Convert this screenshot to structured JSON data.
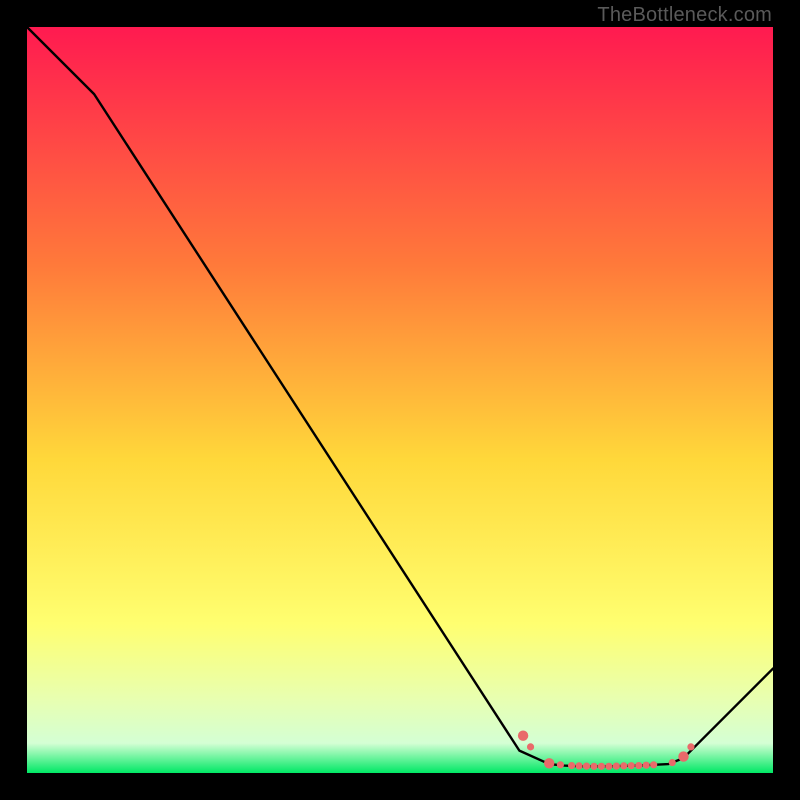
{
  "watermark": "TheBottleneck.com",
  "accent_colors": {
    "gradient_top": "#ff1a50",
    "gradient_mid1": "#ff7a3a",
    "gradient_mid2": "#ffd83a",
    "gradient_low": "#ffff70",
    "gradient_lower": "#e8ffb0",
    "gradient_pale": "#d4ffd4",
    "gradient_bottom": "#00e865",
    "line": "#000000",
    "marker": "#e96a6a"
  },
  "chart_data": {
    "type": "line",
    "title": "",
    "xlabel": "",
    "ylabel": "",
    "xlim": [
      0,
      100
    ],
    "ylim": [
      0,
      100
    ],
    "grid": false,
    "series": [
      {
        "name": "bottleneck-curve",
        "points": [
          {
            "x": 0,
            "y": 100
          },
          {
            "x": 9,
            "y": 91
          },
          {
            "x": 66,
            "y": 3
          },
          {
            "x": 70,
            "y": 1.2
          },
          {
            "x": 72,
            "y": 1.0
          },
          {
            "x": 74,
            "y": 0.9
          },
          {
            "x": 78,
            "y": 0.9
          },
          {
            "x": 82,
            "y": 1.0
          },
          {
            "x": 86,
            "y": 1.2
          },
          {
            "x": 88,
            "y": 2.0
          },
          {
            "x": 100,
            "y": 14
          }
        ]
      }
    ],
    "markers": {
      "name": "highlight-dots",
      "color": "#e96a6a",
      "radius_big": 5.2,
      "radius_small": 3.6,
      "points": [
        {
          "x": 66.5,
          "y": 5.0,
          "r": "big"
        },
        {
          "x": 67.5,
          "y": 3.5,
          "r": "small"
        },
        {
          "x": 70.0,
          "y": 1.3,
          "r": "big"
        },
        {
          "x": 71.5,
          "y": 1.1,
          "r": "small"
        },
        {
          "x": 73.0,
          "y": 1.0,
          "r": "small"
        },
        {
          "x": 74.0,
          "y": 0.95,
          "r": "small"
        },
        {
          "x": 75.0,
          "y": 0.92,
          "r": "small"
        },
        {
          "x": 76.0,
          "y": 0.9,
          "r": "small"
        },
        {
          "x": 77.0,
          "y": 0.9,
          "r": "small"
        },
        {
          "x": 78.0,
          "y": 0.9,
          "r": "small"
        },
        {
          "x": 79.0,
          "y": 0.92,
          "r": "small"
        },
        {
          "x": 80.0,
          "y": 0.95,
          "r": "small"
        },
        {
          "x": 81.0,
          "y": 0.98,
          "r": "small"
        },
        {
          "x": 82.0,
          "y": 1.0,
          "r": "small"
        },
        {
          "x": 83.0,
          "y": 1.05,
          "r": "small"
        },
        {
          "x": 84.0,
          "y": 1.1,
          "r": "small"
        },
        {
          "x": 86.5,
          "y": 1.4,
          "r": "small"
        },
        {
          "x": 88.0,
          "y": 2.2,
          "r": "big"
        },
        {
          "x": 89.0,
          "y": 3.5,
          "r": "small"
        }
      ]
    }
  }
}
